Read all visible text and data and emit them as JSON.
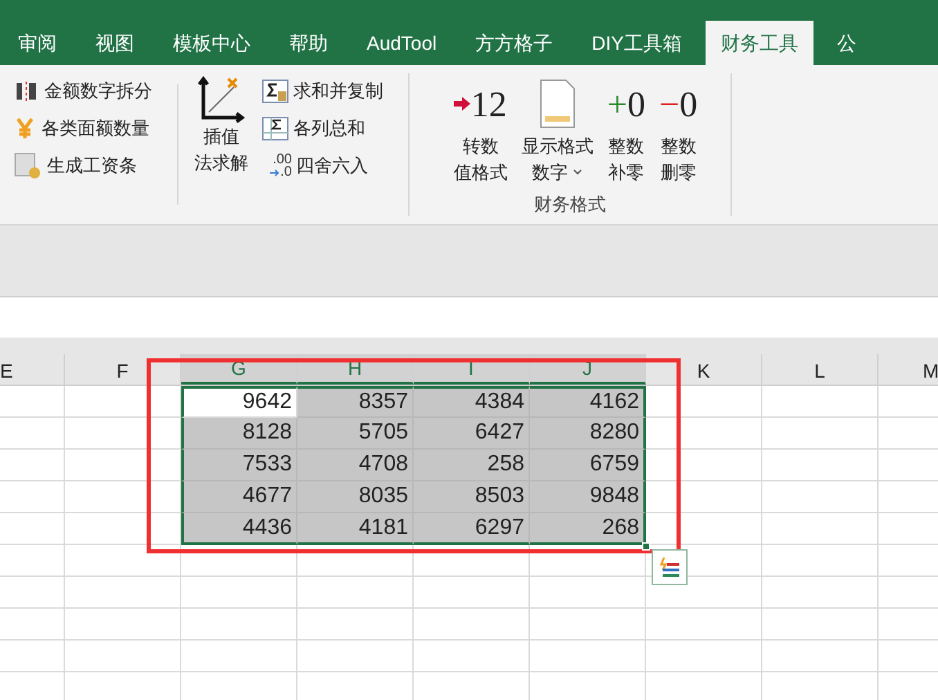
{
  "ribbon_tabs": [
    {
      "label": "审阅",
      "selected": false
    },
    {
      "label": "视图",
      "selected": false
    },
    {
      "label": "模板中心",
      "selected": false
    },
    {
      "label": "帮助",
      "selected": false
    },
    {
      "label": "AudTool",
      "selected": false
    },
    {
      "label": "方方格子",
      "selected": false
    },
    {
      "label": "DIY工具箱",
      "selected": false
    },
    {
      "label": "财务工具",
      "selected": true
    },
    {
      "label": "公",
      "selected": false
    }
  ],
  "ribbon": {
    "group_1": [
      {
        "label": "金额数字拆分",
        "kind": "split"
      },
      {
        "label": "各类面额数量",
        "kind": "yen"
      },
      {
        "label": "生成工资条",
        "kind": "payslip"
      }
    ],
    "interpolate_button": {
      "lines": [
        "插值",
        "法求解"
      ]
    },
    "group_2": [
      {
        "label": "求和并复制",
        "kind": "sumcopy"
      },
      {
        "label": "各列总和",
        "kind": "sum"
      },
      {
        "label": "四舍六入",
        "kind": "round",
        "icon_text": [
          ".00",
          ".0"
        ]
      }
    ],
    "finance_group": {
      "label": "财务格式",
      "buttons": [
        {
          "kind": "arrow",
          "icon_text": "12",
          "lines": [
            "转数",
            "值格式"
          ],
          "dropdown": false
        },
        {
          "kind": "doc",
          "lines": [
            "显示格式",
            "数字"
          ],
          "dropdown": true
        },
        {
          "kind": "plus",
          "icon_text": "+0",
          "lines": [
            "整数",
            "补零"
          ],
          "dropdown": false
        },
        {
          "kind": "minus",
          "icon_text": "−0",
          "lines": [
            "整数",
            "删零"
          ],
          "dropdown": false
        }
      ]
    }
  },
  "sheet": {
    "columns": [
      {
        "label": "E",
        "selected": false
      },
      {
        "label": "F",
        "selected": false
      },
      {
        "label": "G",
        "selected": true
      },
      {
        "label": "H",
        "selected": true
      },
      {
        "label": "I",
        "selected": true
      },
      {
        "label": "J",
        "selected": true
      },
      {
        "label": "K",
        "selected": false
      },
      {
        "label": "L",
        "selected": false
      },
      {
        "label": "M",
        "selected": false
      }
    ],
    "rows": [
      [
        {
          "text": "9642",
          "selected": false
        },
        {
          "text": "8357",
          "selected": true
        },
        {
          "text": "4384",
          "selected": true
        },
        {
          "text": "4162",
          "selected": true
        }
      ],
      [
        {
          "text": "8128",
          "selected": true
        },
        {
          "text": "5705",
          "selected": true
        },
        {
          "text": "6427",
          "selected": true
        },
        {
          "text": "8280",
          "selected": true
        }
      ],
      [
        {
          "text": "7533",
          "selected": true
        },
        {
          "text": "4708",
          "selected": true
        },
        {
          "text": "258",
          "selected": true
        },
        {
          "text": "6759",
          "selected": true
        }
      ],
      [
        {
          "text": "4677",
          "selected": true
        },
        {
          "text": "8035",
          "selected": true
        },
        {
          "text": "8503",
          "selected": true
        },
        {
          "text": "9848",
          "selected": true
        }
      ],
      [
        {
          "text": "4436",
          "selected": true
        },
        {
          "text": "4181",
          "selected": true
        },
        {
          "text": "6297",
          "selected": true
        },
        {
          "text": "268",
          "selected": true
        }
      ]
    ]
  }
}
